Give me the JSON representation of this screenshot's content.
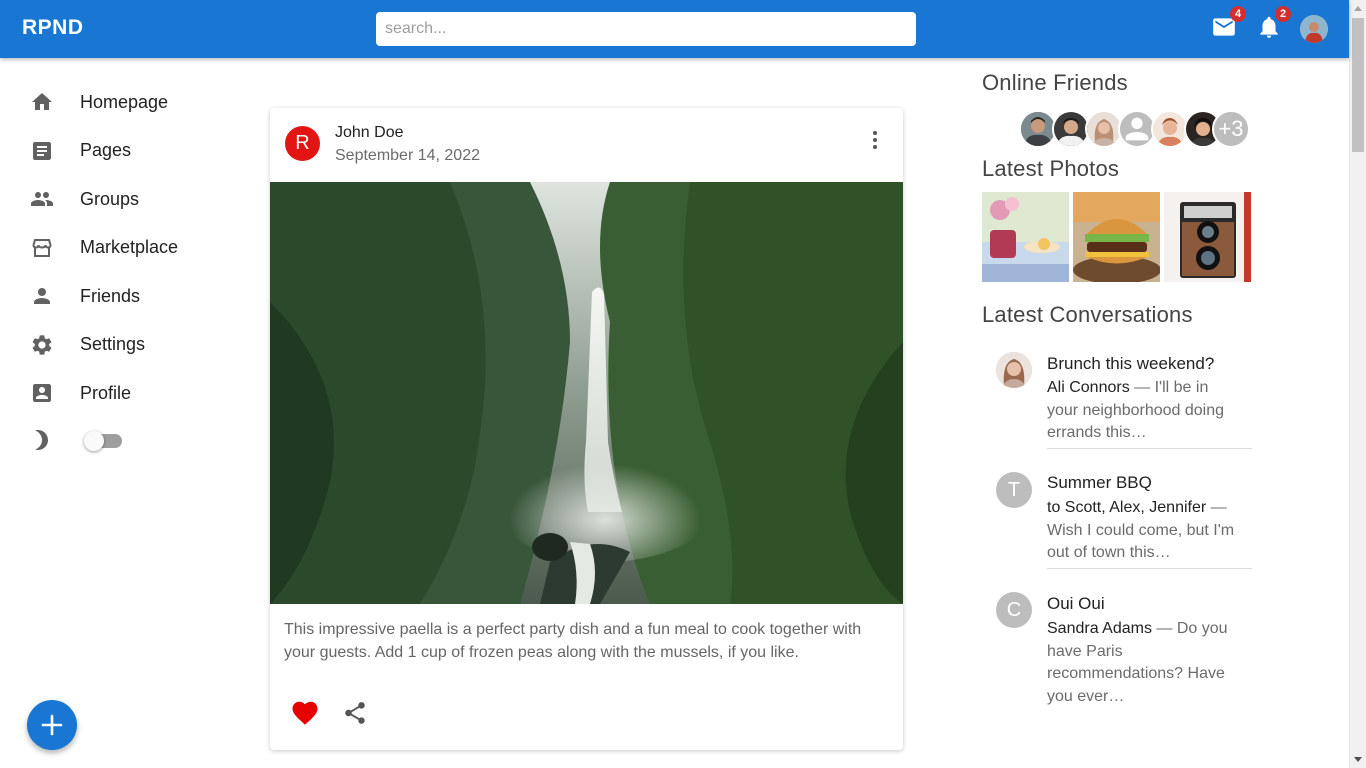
{
  "app": {
    "name": "RPND"
  },
  "search": {
    "placeholder": "search..."
  },
  "header": {
    "mail_count": "4",
    "notifications_count": "2"
  },
  "sidebar": {
    "items": [
      {
        "label": "Homepage",
        "icon": "home-icon"
      },
      {
        "label": "Pages",
        "icon": "article-icon"
      },
      {
        "label": "Groups",
        "icon": "groups-icon"
      },
      {
        "label": "Marketplace",
        "icon": "storefront-icon"
      },
      {
        "label": "Friends",
        "icon": "person-icon"
      },
      {
        "label": "Settings",
        "icon": "gear-icon"
      },
      {
        "label": "Profile",
        "icon": "account-box-icon"
      }
    ],
    "dark_mode": false
  },
  "post": {
    "avatar_letter": "R",
    "author": "John Doe",
    "date": "September 14, 2022",
    "text": "This impressive paella is a perfect party dish and a fun meal to cook together with your guests. Add 1 cup of frozen peas along with the mussels, if you like.",
    "liked": true
  },
  "right": {
    "online_title": "Online Friends",
    "online_more": "+3",
    "photos_title": "Latest Photos",
    "conversations_title": "Latest Conversations",
    "conversations": [
      {
        "title": "Brunch this weekend?",
        "sender": "Ali Connors",
        "snippet": " — I'll be in your neighborhood doing errands this…",
        "avatar": "photo"
      },
      {
        "title": "Summer BBQ",
        "sender": "to Scott, Alex, Jennifer",
        "snippet": " — Wish I could come, but I'm out of town this…",
        "avatar": "T"
      },
      {
        "title": "Oui Oui",
        "sender": "Sandra Adams",
        "snippet": " — Do you have Paris recommendations? Have you ever…",
        "avatar": "C"
      }
    ]
  },
  "colors": {
    "primary": "#1976d2",
    "badge": "#d32f2f",
    "like": "#e60000",
    "post_avatar": "#e31414"
  }
}
